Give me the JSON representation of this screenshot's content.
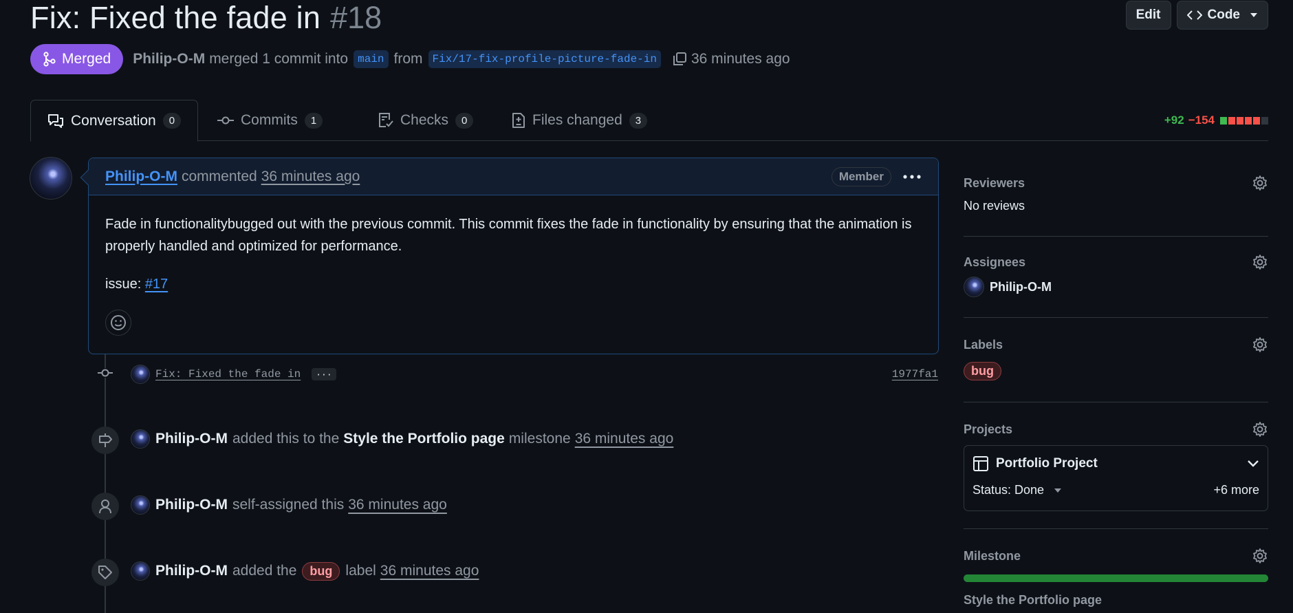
{
  "header": {
    "title": "Fix: Fixed the fade in",
    "number": "#18",
    "edit_label": "Edit",
    "code_label": "Code"
  },
  "meta": {
    "state": "Merged",
    "user": "Philip-O-M",
    "action": "merged 1 commit into",
    "base_branch": "main",
    "from_word": "from",
    "head_branch": "Fix/17-fix-profile-picture-fade-in",
    "time": "36 minutes ago"
  },
  "tabs": [
    {
      "label": "Conversation",
      "count": "0",
      "icon": "comment-discussion-icon"
    },
    {
      "label": "Commits",
      "count": "1",
      "icon": "git-commit-icon"
    },
    {
      "label": "Checks",
      "count": "0",
      "icon": "checklist-icon"
    },
    {
      "label": "Files changed",
      "count": "3",
      "icon": "file-diff-icon"
    }
  ],
  "diffstat": {
    "additions": "+92",
    "deletions": "−154",
    "blocks": [
      "green",
      "red",
      "red",
      "red",
      "red",
      "gray"
    ]
  },
  "comment": {
    "author": "Philip-O-M",
    "verb": "commented",
    "time": "36 minutes ago",
    "role": "Member",
    "body": "Fade in functionalitybugged out with the previous commit. This commit fixes the fade in functionality by ensuring that the animation is properly handled and optimized for performance.",
    "issue_prefix": "issue:",
    "issue_link": "#17"
  },
  "timeline": {
    "commit": {
      "message": "Fix: Fixed the fade in",
      "ellipsis": "···",
      "sha": "1977fa1"
    },
    "milestone_event": {
      "user": "Philip-O-M",
      "pre": "added this to the",
      "milestone": "Style the Portfolio page",
      "post": "milestone",
      "time": "36 minutes ago"
    },
    "assign_event": {
      "user": "Philip-O-M",
      "text": "self-assigned this",
      "time": "36 minutes ago"
    },
    "label_event": {
      "user": "Philip-O-M",
      "pre": "added the",
      "label": "bug",
      "post": "label",
      "time": "36 minutes ago"
    }
  },
  "sidebar": {
    "reviewers": {
      "title": "Reviewers",
      "value": "No reviews"
    },
    "assignees": {
      "title": "Assignees",
      "value": "Philip-O-M"
    },
    "labels": {
      "title": "Labels",
      "value": "bug"
    },
    "projects": {
      "title": "Projects",
      "name": "Portfolio Project",
      "status": "Status: Done",
      "more": "+6 more"
    },
    "milestone": {
      "title": "Milestone",
      "progress": 1.0,
      "name": "Style the Portfolio page"
    }
  },
  "colors": {
    "merged": "#8957e5",
    "link": "#4493f8",
    "additions": "#3fb950",
    "deletions": "#f85149",
    "progress": "#238636"
  }
}
